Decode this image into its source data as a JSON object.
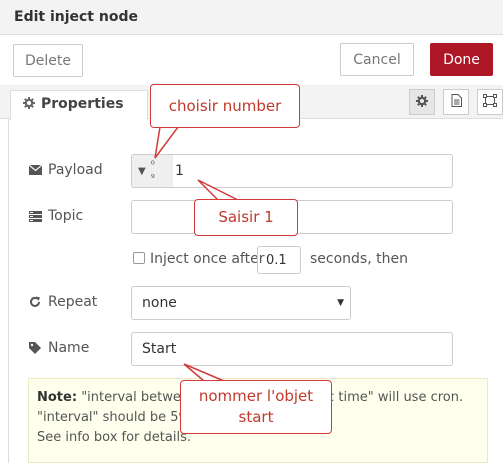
{
  "dialog": {
    "title": "Edit inject node",
    "delete_label": "Delete",
    "cancel_label": "Cancel",
    "done_label": "Done",
    "accent_color": "#ad1625"
  },
  "tabs": {
    "properties_label": "Properties",
    "icons": [
      "gear-icon",
      "document-icon",
      "frame-icon"
    ]
  },
  "form": {
    "payload": {
      "label": "Payload",
      "type_symbol": "0\n9",
      "value": "1"
    },
    "topic": {
      "label": "Topic",
      "value": ""
    },
    "inject_once": {
      "label": "Inject once after",
      "checked": false,
      "delay": "0.1",
      "suffix": "seconds, then"
    },
    "repeat": {
      "label": "Repeat",
      "value": "none"
    },
    "name": {
      "label": "Name",
      "value": "Start"
    }
  },
  "note": {
    "title": "Note:",
    "line1": "\"interval between",
    "line1_end": "c time\" will use cron.",
    "line2": "\"interval\" should be 596",
    "line3": "See info box for details."
  },
  "annotations": {
    "choose_number": "choisir number",
    "enter_one": "Saisir 1",
    "name_object_1": "nommer l'objet",
    "name_object_2": "start",
    "color": "#d33a3a"
  }
}
